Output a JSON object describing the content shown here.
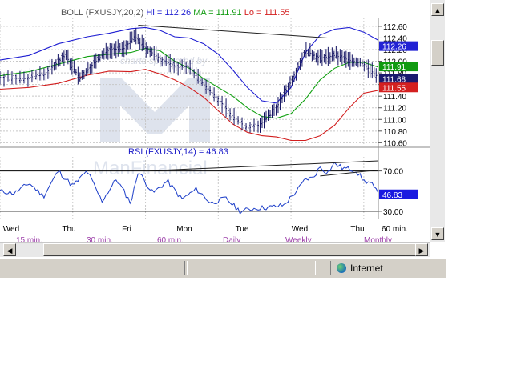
{
  "chart_data": [
    {
      "type": "candlestick",
      "title": "BOLL (FXUSJY,20,2)",
      "stats": [
        {
          "label": "Hi =",
          "value": "112.26"
        },
        {
          "label": "MA =",
          "value": "111.91"
        },
        {
          "label": "Lo =",
          "value": "111.55"
        }
      ],
      "y_ticks": [
        "112.60",
        "112.40",
        "112.20",
        "112.00",
        "111.80",
        "111.60",
        "111.40",
        "111.20",
        "111.00",
        "110.80",
        "110.60"
      ],
      "ylim": [
        110.55,
        112.75
      ],
      "series": [
        {
          "name": "Hi",
          "color": "#1e1ed2"
        },
        {
          "name": "MA",
          "color": "#10a010"
        },
        {
          "name": "Lo",
          "color": "#d21e1e"
        }
      ],
      "price_t": [
        0,
        6,
        12,
        18,
        22,
        26,
        30,
        34,
        37,
        40,
        44,
        48,
        52,
        56,
        60,
        64,
        68,
        71,
        74,
        77,
        80,
        84,
        88,
        92,
        96,
        100,
        104
      ],
      "price": [
        111.72,
        111.7,
        111.77,
        112.1,
        111.7,
        111.98,
        112.2,
        112.21,
        112.43,
        112.23,
        112.04,
        111.92,
        111.9,
        111.6,
        111.35,
        111.05,
        110.85,
        110.9,
        111.05,
        111.3,
        111.65,
        112.18,
        112.05,
        112.1,
        112.02,
        111.95,
        111.72
      ],
      "upper_t": [
        0,
        8,
        16,
        24,
        30,
        36,
        40,
        44,
        48,
        52,
        56,
        60,
        64,
        68,
        72,
        76,
        80,
        84,
        88,
        92,
        96,
        100,
        104
      ],
      "upper": [
        112.02,
        112.1,
        112.3,
        112.42,
        112.48,
        112.56,
        112.58,
        112.53,
        112.42,
        112.4,
        112.3,
        112.12,
        111.85,
        111.55,
        111.32,
        111.28,
        111.55,
        112.15,
        112.45,
        112.55,
        112.58,
        112.5,
        112.36
      ],
      "ma_t": [
        0,
        8,
        16,
        24,
        30,
        36,
        40,
        44,
        48,
        52,
        56,
        60,
        64,
        68,
        72,
        76,
        80,
        84,
        88,
        92,
        96,
        100,
        104
      ],
      "ma": [
        111.75,
        111.82,
        111.95,
        112.08,
        112.12,
        112.15,
        112.22,
        112.18,
        112.0,
        111.88,
        111.7,
        111.55,
        111.4,
        111.2,
        111.05,
        111.02,
        111.1,
        111.35,
        111.68,
        111.88,
        111.98,
        111.98,
        111.9
      ],
      "lower_t": [
        0,
        8,
        16,
        24,
        30,
        36,
        40,
        44,
        48,
        52,
        56,
        60,
        64,
        68,
        72,
        76,
        80,
        84,
        88,
        92,
        96,
        100,
        104
      ],
      "lower": [
        111.52,
        111.55,
        111.62,
        111.76,
        111.83,
        111.82,
        111.86,
        111.78,
        111.68,
        111.55,
        111.38,
        111.15,
        110.92,
        110.78,
        110.72,
        110.7,
        110.64,
        110.64,
        110.72,
        110.9,
        111.2,
        111.45,
        111.5
      ],
      "trendline": {
        "t": [
          38,
          90
        ],
        "value": [
          112.62,
          112.4
        ]
      },
      "tags": [
        {
          "text": "112.26",
          "value": 112.26,
          "color": "#2222d4"
        },
        {
          "text": "111.91",
          "value": 111.91,
          "color": "#109a10"
        },
        {
          "text": "111.68",
          "value": 111.7,
          "color": "#1a1a6e"
        },
        {
          "text": "111.55",
          "value": 111.55,
          "color": "#d42020"
        }
      ]
    },
    {
      "type": "line",
      "title": "RSI (FXUSJY,14)",
      "value_label": "= 46.83",
      "y_ticks": [
        "70.00",
        "30.00"
      ],
      "ylim": [
        22,
        84
      ],
      "levels": [
        70,
        30
      ],
      "rsi_t": [
        0,
        4,
        8,
        12,
        16,
        20,
        24,
        28,
        32,
        36,
        38,
        42,
        46,
        50,
        54,
        58,
        62,
        66,
        70,
        74,
        78,
        82,
        84,
        86,
        88,
        90,
        92,
        94,
        96,
        98,
        100,
        102,
        104
      ],
      "rsi": [
        50,
        48,
        58,
        45,
        70,
        55,
        70,
        40,
        62,
        38,
        70,
        48,
        60,
        42,
        52,
        38,
        43,
        30,
        33,
        34,
        36,
        52,
        62,
        63,
        74,
        68,
        78,
        73,
        72,
        70,
        60,
        58,
        46.8
      ],
      "trendlines": [
        {
          "t": [
            40,
            104
          ],
          "value": [
            70.0,
            80.0
          ]
        },
        {
          "t": [
            88,
            104
          ],
          "value": [
            65.0,
            71.0
          ]
        }
      ],
      "tag": {
        "text": "46.83",
        "value": 46.83,
        "color": "#1a1ae0"
      },
      "x_ticks": [
        {
          "label": "Wed",
          "t": 0
        },
        {
          "label": "Thu",
          "t": 20
        },
        {
          "label": "Fri",
          "t": 40
        },
        {
          "label": "Mon",
          "t": 60
        },
        {
          "label": "Tue",
          "t": 80
        },
        {
          "label": "Wed",
          "t": 100
        }
      ]
    }
  ],
  "x_axis": {
    "labels": [
      "Wed",
      "Thu",
      "Fri",
      "Mon",
      "Tue",
      "Wed",
      "Thu"
    ],
    "timeframe": "60 min."
  },
  "timeframe_links": [
    "15 min.",
    "30 min.",
    "60 min.",
    "Daily",
    "Weekly",
    "Monthly"
  ],
  "watermark": {
    "brand": "ManFinancial",
    "sponsor": "charts sponsored by"
  },
  "status_bar": {
    "zone": "Internet"
  },
  "scroll_glyphs": {
    "up": "▲",
    "down": "▼",
    "left": "◀",
    "right": "▶"
  },
  "colors": {
    "grid": "#c8c8c8",
    "candle": "#101060",
    "upper": "#1e1ed2",
    "ma": "#10a010",
    "lower": "#d21e1e",
    "rsi": "#1a3cc8"
  }
}
